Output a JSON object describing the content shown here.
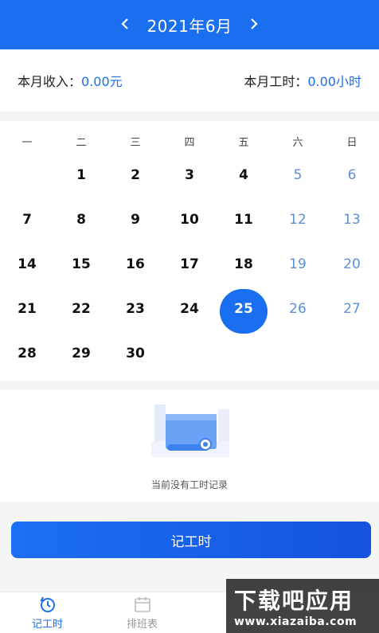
{
  "header": {
    "title": "2021年6月",
    "prev_icon": "chevron-left-icon",
    "next_icon": "chevron-right-icon"
  },
  "stats": {
    "income_label": "本月收入：",
    "income_value": "0.00元",
    "hours_label": "本月工时：",
    "hours_value": "0.00小时"
  },
  "calendar": {
    "weekdays": [
      "一",
      "二",
      "三",
      "四",
      "五",
      "六",
      "日"
    ],
    "leading_blanks": 1,
    "days": [
      "1",
      "2",
      "3",
      "4",
      "5",
      "6",
      "7",
      "8",
      "9",
      "10",
      "11",
      "12",
      "13",
      "14",
      "15",
      "16",
      "17",
      "18",
      "19",
      "20",
      "21",
      "22",
      "23",
      "24",
      "25",
      "26",
      "27",
      "28",
      "29",
      "30"
    ],
    "selected_day": "25",
    "weekend_color": "#5b8fd6",
    "accent_color": "#1a6ef0"
  },
  "empty_state": {
    "text": "当前没有工时记录",
    "icon": "empty-document-illustration"
  },
  "cta": {
    "label": "记工时"
  },
  "tabbar": {
    "items": [
      {
        "label": "记工时",
        "icon": "clock-refresh-icon",
        "active": true
      },
      {
        "label": "排班表",
        "icon": "calendar-icon",
        "active": false
      },
      {
        "label": "",
        "icon": "",
        "active": false
      },
      {
        "label": "",
        "icon": "",
        "active": false
      }
    ]
  },
  "watermark": {
    "title": "下载吧应用",
    "url": "www.xiazaiba.com"
  }
}
